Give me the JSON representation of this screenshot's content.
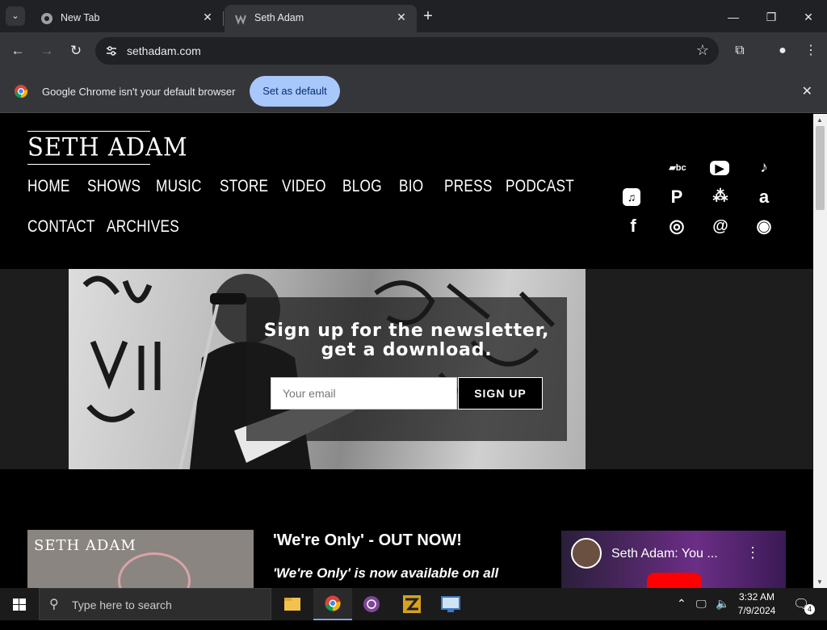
{
  "browser": {
    "tabs": [
      {
        "title": "New Tab",
        "active": false
      },
      {
        "title": "Seth Adam",
        "active": true
      }
    ],
    "url": "sethadam.com",
    "infobar": {
      "message": "Google Chrome isn't your default browser",
      "button": "Set as default"
    }
  },
  "site": {
    "logo": "SETH ADAM",
    "nav": [
      "HOME",
      "SHOWS",
      "MUSIC",
      "STORE",
      "VIDEO",
      "BLOG",
      "BIO",
      "PRESS",
      "PODCAST",
      "CONTACT",
      "ARCHIVES"
    ],
    "social": [
      {
        "name": "bandcamp-icon",
        "glyph": "▰bc"
      },
      {
        "name": "youtube-icon",
        "glyph": "▶"
      },
      {
        "name": "tiktok-icon",
        "glyph": "♪"
      },
      {
        "name": "apple-music-icon",
        "glyph": "♫"
      },
      {
        "name": "pandora-icon",
        "glyph": "P"
      },
      {
        "name": "tidal-icon",
        "glyph": "⁂"
      },
      {
        "name": "amazon-icon",
        "glyph": "a"
      },
      {
        "name": "facebook-icon",
        "glyph": "f"
      },
      {
        "name": "instagram-icon",
        "glyph": "◎"
      },
      {
        "name": "threads-icon",
        "glyph": "@"
      },
      {
        "name": "spotify-icon",
        "glyph": "◉"
      }
    ],
    "newsletter": {
      "title": "Sign up for the newsletter, get a download.",
      "placeholder": "Your email",
      "button": "SIGN UP"
    },
    "release": {
      "album_logo": "SETH ADAM",
      "title": "'We're Only' - OUT NOW!",
      "subtitle": "'We're Only' is now available on all"
    },
    "video": {
      "title": "Seth Adam: You ..."
    }
  },
  "taskbar": {
    "search_placeholder": "Type here to search",
    "time": "3:32 AM",
    "date": "7/9/2024",
    "notifications": "4"
  }
}
